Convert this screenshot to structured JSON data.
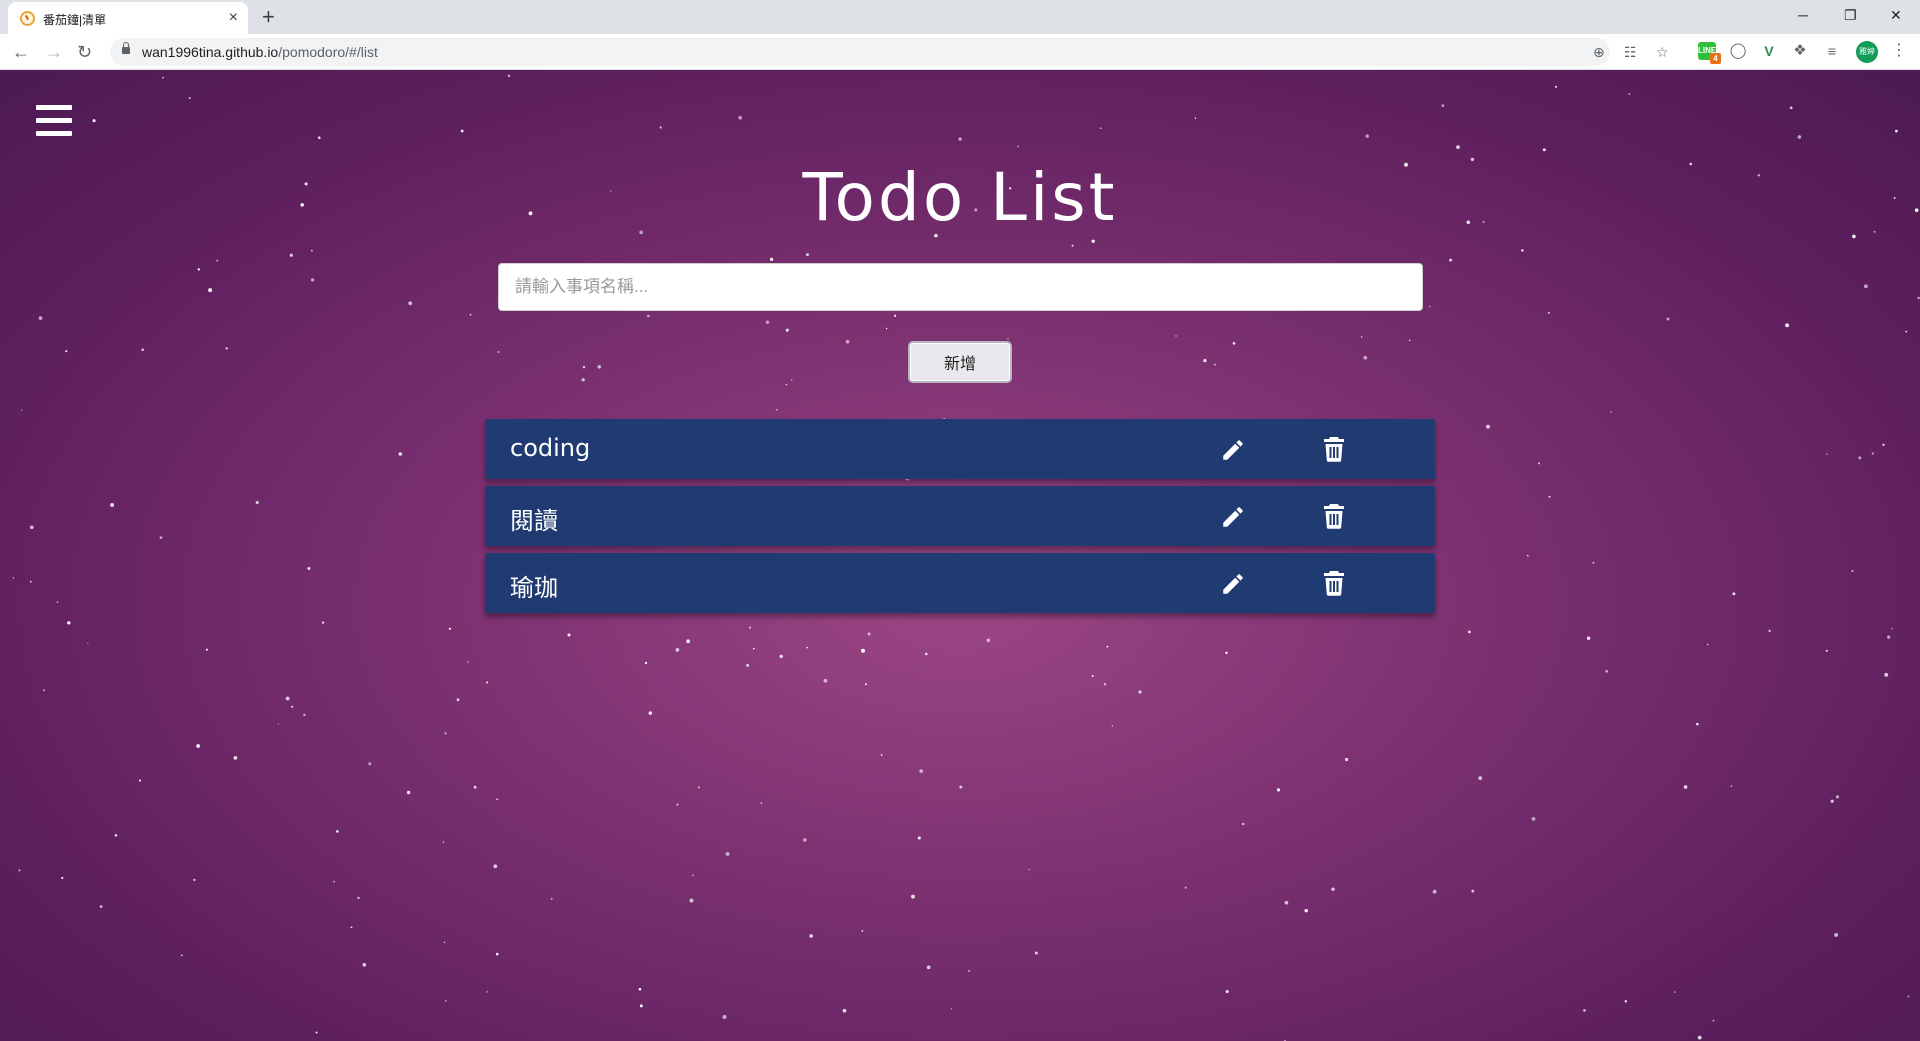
{
  "browser": {
    "tab_title": "番茄鐘|清單",
    "tab_close": "×",
    "new_tab": "+",
    "url_host": "wan1996tina.github.io",
    "url_path": "/pomodoro/#/list",
    "window_controls": {
      "minimize": "─",
      "restore": "❐",
      "close": "✕"
    },
    "extension_badge": "4",
    "profile_initials": "雅婷"
  },
  "app": {
    "menu_icon": "hamburger-icon",
    "title": "Todo List",
    "input_placeholder": "請輸入事項名稱...",
    "add_button_label": "新增",
    "todos": [
      {
        "text": "coding",
        "edit_icon": "pencil-icon",
        "delete_icon": "trash-icon"
      },
      {
        "text": "閱讀",
        "edit_icon": "pencil-icon",
        "delete_icon": "trash-icon"
      },
      {
        "text": "瑜珈",
        "edit_icon": "pencil-icon",
        "delete_icon": "trash-icon"
      }
    ]
  },
  "colors": {
    "background": "#7e3272",
    "todo_item": "#203a72",
    "text": "#ffffff"
  }
}
